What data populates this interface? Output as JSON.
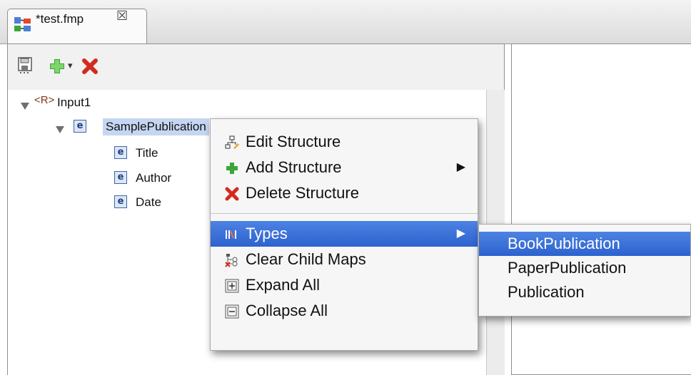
{
  "tab": {
    "title": "*test.fmp",
    "close": "☒"
  },
  "toolbar": {
    "save_icon": "save-icon",
    "add_icon": "add-icon",
    "add_dropdown": "▾",
    "delete_icon": "delete-icon"
  },
  "tree": {
    "root": {
      "badge": "<R>",
      "label": "Input1"
    },
    "element": {
      "badge": "e",
      "label": "SamplePublication"
    },
    "children": [
      {
        "badge": "e",
        "label": "Title"
      },
      {
        "badge": "e",
        "label": "Author"
      },
      {
        "badge": "e",
        "label": "Date"
      }
    ]
  },
  "context_menu": {
    "items": [
      {
        "label": "Edit Structure",
        "icon": "edit-structure-icon"
      },
      {
        "label": "Add Structure",
        "icon": "add-icon",
        "submenu": "▶"
      },
      {
        "label": "Delete Structure",
        "icon": "delete-icon"
      },
      {
        "label": "Types",
        "icon": "types-icon",
        "submenu": "▶",
        "highlighted": true
      },
      {
        "label": "Clear Child Maps",
        "icon": "clear-maps-icon"
      },
      {
        "label": "Expand All",
        "icon": "expand-all-icon"
      },
      {
        "label": "Collapse All",
        "icon": "collapse-all-icon"
      }
    ]
  },
  "types_submenu": {
    "items": [
      {
        "label": "BookPublication",
        "highlighted": true
      },
      {
        "label": "PaperPublication"
      },
      {
        "label": "Publication"
      }
    ]
  },
  "colors": {
    "highlight": "#3a6fd8",
    "selection": "#c5d6f2",
    "add_green": "#3aa639",
    "delete_red": "#d42a1e"
  }
}
